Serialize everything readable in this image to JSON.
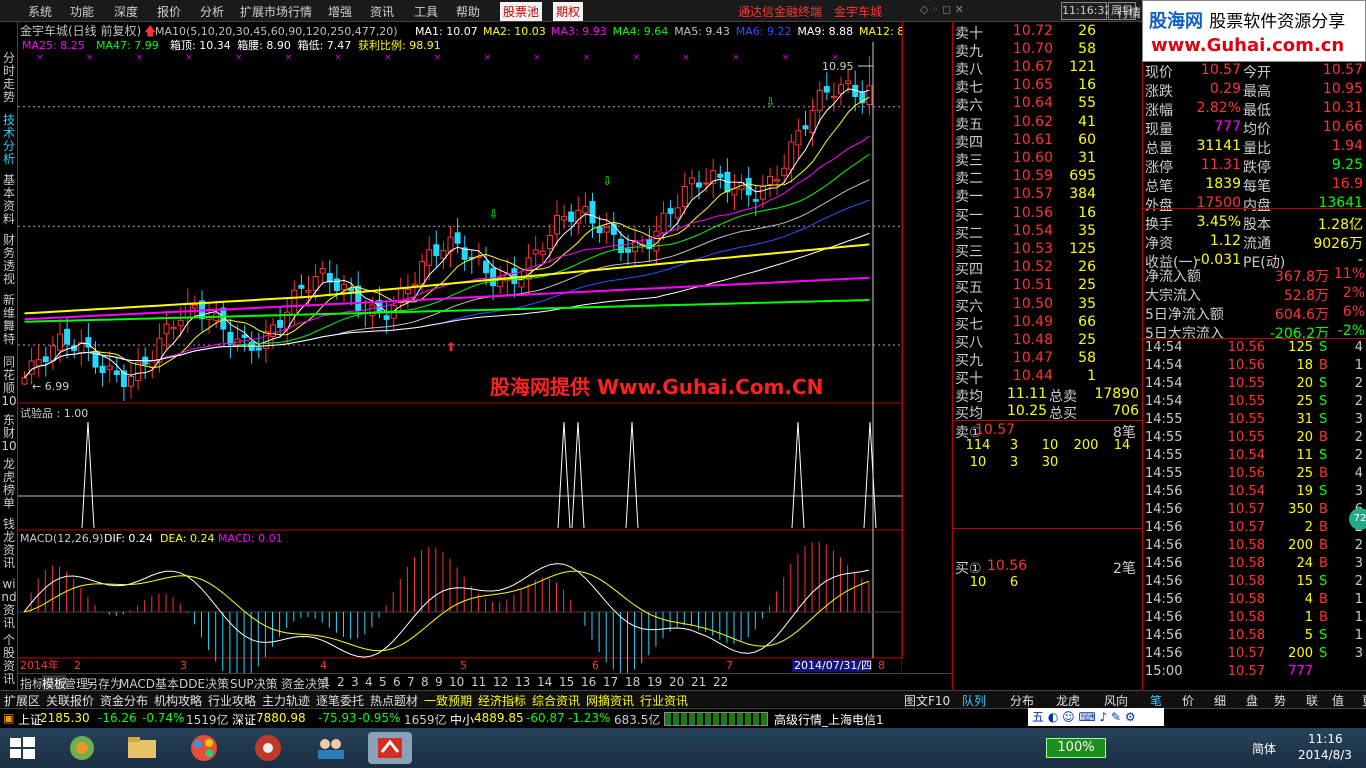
{
  "menu": {
    "items": [
      "系统",
      "功能",
      "深度",
      "报价",
      "分析",
      "扩展市场行情",
      "增强",
      "资讯",
      "工具",
      "帮助"
    ],
    "hl1": "股票池",
    "hl2": "期权",
    "link1": "通达信金融终端",
    "link2": "金宇车城",
    "time": "11:16:32",
    "weekday": "周日",
    "quotes_btn": "行情"
  },
  "logo": {
    "brand": "股海网",
    "slogan": "股票软件资源分享",
    "url": "www.Guhai.com.cn"
  },
  "sidenav": [
    "分时走势",
    "技术分析",
    "基本资料",
    "财务透视",
    "新维舞特",
    "同花顺10",
    "东财10",
    "龙虎榜单",
    "钱龙资讯",
    "wind资讯",
    "个股资讯"
  ],
  "chart": {
    "title": "金宇车城(日线 前复权)",
    "ma_line1": [
      {
        "t": "MA10(5,10,20,30,45,60,90,120,250,477,20)",
        "c": "#c0c0c0"
      },
      {
        "t": "MA1: 10.07",
        "c": "#ffffff"
      },
      {
        "t": "MA2: 10.03",
        "c": "#ffff00"
      },
      {
        "t": "MA3: 9.93",
        "c": "#ff00ff"
      },
      {
        "t": "MA4: 9.64",
        "c": "#00ff00"
      },
      {
        "t": "MA5: 9.43",
        "c": "#c0c0c0"
      },
      {
        "t": "MA6: 9.22",
        "c": "#3050ff"
      },
      {
        "t": "MA9: 8.88",
        "c": "#ffffff"
      },
      {
        "t": "MA12: 8.6",
        "c": "#ffff00"
      }
    ],
    "ma_line2": [
      {
        "t": "MA25: 8.25",
        "c": "#ff00ff"
      },
      {
        "t": "MA47: 7.99",
        "c": "#00ff00"
      },
      {
        "t": "箱顶: 10.34",
        "c": "#ffffff"
      },
      {
        "t": "箱腰: 8.90",
        "c": "#ffffff"
      },
      {
        "t": "箱低: 7.47",
        "c": "#ffffff"
      },
      {
        "t": "获利比例: 98.91",
        "c": "#ffff00"
      }
    ],
    "watermark": "股海网提供 Www.Guhai.Com.CN",
    "hi_label": "10.95",
    "lo_label": "6.99",
    "price_axis": [
      "11.00",
      "10.50",
      "10.00",
      "9.50",
      "9.00",
      "8.50",
      "8.00",
      "7.50",
      "7.00"
    ],
    "ind_title": "试验品 : 1.00",
    "ind_axis": [
      "0.50"
    ],
    "ind_value": "0.31",
    "macd_title": "MACD(12,26,9)",
    "dif": "DIF: 0.24",
    "dea": "DEA: 0.24",
    "macd": "MACD: 0.01",
    "macd_axis": [
      "0.15",
      "0.00"
    ],
    "dates": [
      "2014年",
      "2",
      "3",
      "4",
      "5",
      "6",
      "7",
      "8"
    ],
    "cursor_date": "2014/07/31/四",
    "period": "日线"
  },
  "tabs1": [
    "指标",
    "模板",
    "管理",
    "另存为",
    "MACD基本",
    "DDE决策",
    "SUP决策",
    "资金决策",
    "1",
    "2",
    "3",
    "4",
    "5",
    "6",
    "7",
    "8",
    "9",
    "10",
    "11",
    "12",
    "13",
    "14",
    "15",
    "16",
    "17",
    "18",
    "19",
    "20",
    "21",
    "22"
  ],
  "tabs2": [
    "扩展区",
    "关联报价",
    "资金分布",
    "机构攻略",
    "行业攻略",
    "主力轨迹",
    "逐笔委托",
    "热点题材",
    "一致预期",
    "经济指标",
    "综合资讯",
    "网摘资讯",
    "行业资讯"
  ],
  "tabs2_right": "图文F10",
  "orderbook": {
    "asks": [
      [
        "卖十",
        "10.72",
        "26"
      ],
      [
        "卖九",
        "10.70",
        "58"
      ],
      [
        "卖八",
        "10.67",
        "121"
      ],
      [
        "卖七",
        "10.65",
        "16"
      ],
      [
        "卖六",
        "10.64",
        "55"
      ],
      [
        "卖五",
        "10.62",
        "41"
      ],
      [
        "卖四",
        "10.61",
        "60"
      ],
      [
        "卖三",
        "10.60",
        "31"
      ],
      [
        "卖二",
        "10.59",
        "695"
      ],
      [
        "卖一",
        "10.57",
        "384"
      ]
    ],
    "bids": [
      [
        "买一",
        "10.56",
        "16"
      ],
      [
        "买二",
        "10.54",
        "35"
      ],
      [
        "买三",
        "10.53",
        "125"
      ],
      [
        "买四",
        "10.52",
        "26"
      ],
      [
        "买五",
        "10.51",
        "25"
      ],
      [
        "买六",
        "10.50",
        "35"
      ],
      [
        "买七",
        "10.49",
        "66"
      ],
      [
        "买八",
        "10.48",
        "25"
      ],
      [
        "买九",
        "10.47",
        "58"
      ],
      [
        "买十",
        "10.44",
        "1"
      ]
    ],
    "avg_ask": [
      "卖均",
      "11.11",
      "总卖",
      "17890"
    ],
    "avg_bid": [
      "买均",
      "10.25",
      "总买",
      "706"
    ],
    "sell1_label": "卖①",
    "sell1_price": "10.57",
    "sell1_count": "8笔",
    "sell1_qty": [
      "114",
      "3",
      "10",
      "200",
      "14",
      "10",
      "3",
      "30"
    ],
    "buy1_label": "买①",
    "buy1_price": "10.56",
    "buy1_count": "2笔",
    "buy1_qty": [
      "10",
      "6"
    ]
  },
  "stats": [
    [
      "现价",
      "10.57",
      "今开",
      "10.57"
    ],
    [
      "涨跌",
      "0.29",
      "最高",
      "10.95"
    ],
    [
      "涨幅",
      "2.82%",
      "最低",
      "10.31"
    ],
    [
      "现量",
      "777",
      "均价",
      "10.66"
    ],
    [
      "总量",
      "31141",
      "量比",
      "1.94"
    ],
    [
      "涨停",
      "11.31",
      "跌停",
      "9.25"
    ],
    [
      "总笔",
      "1839",
      "每笔",
      "16.9"
    ],
    [
      "外盘",
      "17500",
      "内盘",
      "13641"
    ],
    [
      "换手",
      "3.45%",
      "股本",
      "1.28亿"
    ],
    [
      "净资",
      "1.12",
      "流通",
      "9026万"
    ],
    [
      "收益(一)",
      "-0.031",
      "PE(动)",
      "-"
    ],
    [
      "净流入额",
      "",
      "367.8万",
      "11%"
    ],
    [
      "大宗流入",
      "",
      "52.8万",
      "2%"
    ],
    [
      "5日净流入额",
      "",
      "604.6万",
      "6%"
    ],
    [
      "5日大宗流入",
      "",
      "-206.2万",
      "-2%"
    ]
  ],
  "ticks": [
    [
      "14:54",
      "10.56",
      "125",
      "S",
      "4"
    ],
    [
      "14:54",
      "10.56",
      "18",
      "B",
      "1"
    ],
    [
      "14:54",
      "10.55",
      "20",
      "S",
      "2"
    ],
    [
      "14:54",
      "10.55",
      "25",
      "S",
      "2"
    ],
    [
      "14:55",
      "10.55",
      "31",
      "S",
      "3"
    ],
    [
      "14:55",
      "10.55",
      "20",
      "B",
      "2"
    ],
    [
      "14:55",
      "10.54",
      "11",
      "S",
      "2"
    ],
    [
      "14:55",
      "10.56",
      "25",
      "B",
      "4"
    ],
    [
      "14:56",
      "10.54",
      "19",
      "S",
      "3"
    ],
    [
      "14:56",
      "10.57",
      "350",
      "B",
      "6"
    ],
    [
      "14:56",
      "10.57",
      "2",
      "B",
      "2"
    ],
    [
      "14:56",
      "10.58",
      "200",
      "B",
      "2"
    ],
    [
      "14:56",
      "10.58",
      "24",
      "B",
      "3"
    ],
    [
      "14:56",
      "10.58",
      "15",
      "S",
      "2"
    ],
    [
      "14:56",
      "10.58",
      "4",
      "B",
      "1"
    ],
    [
      "14:56",
      "10.58",
      "1",
      "B",
      "1"
    ],
    [
      "14:56",
      "10.58",
      "5",
      "S",
      "1"
    ],
    [
      "14:56",
      "10.57",
      "200",
      "S",
      "3"
    ],
    [
      "15:00",
      "10.57",
      "777",
      "",
      ""
    ]
  ],
  "rtabs": [
    "队列",
    "分布",
    "龙虎",
    "风向",
    "笔",
    "价",
    "细",
    "盘",
    "势",
    "联",
    "值",
    "更"
  ],
  "status": {
    "sh_name": "上证",
    "sh": "2185.30",
    "sh_chg": "-16.26",
    "sh_pct": "-0.74%",
    "sh_amt": "1519亿",
    "sz_name": "深证",
    "sz": "7880.98",
    "sz_chg": "-75.93",
    "sz_pct": "-0.95%",
    "sz_amt": "1659亿",
    "zx_name": "中小",
    "zx": "4889.85",
    "zx_chg": "-60.87",
    "zx_pct": "-1.23%",
    "zx_amt": "683.5亿",
    "right": "高级行情_上海电信1"
  },
  "taskbar": {
    "zoom": "100%",
    "lang": "简体",
    "time": "11:16",
    "date": "2014/8/3",
    "ime": "五"
  }
}
